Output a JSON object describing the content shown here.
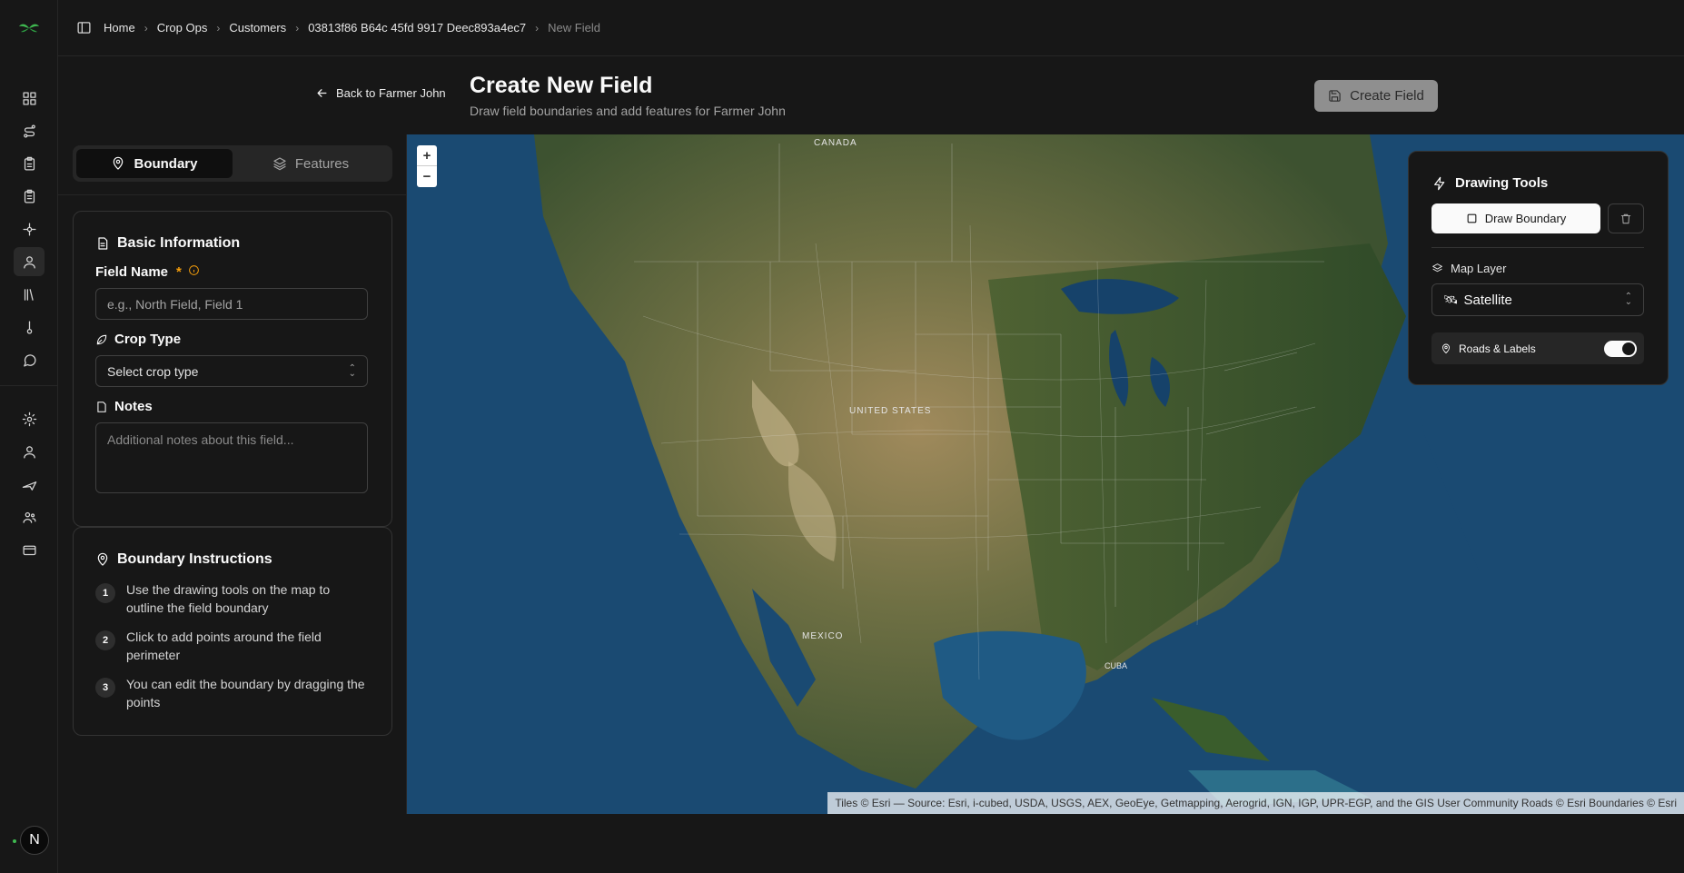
{
  "breadcrumbs": [
    "Home",
    "Crop Ops",
    "Customers",
    "03813f86 B64c 45fd 9917 Deec893a4ec7",
    "New Field"
  ],
  "header": {
    "back_label": "Back to Farmer John",
    "title": "Create New Field",
    "subtitle": "Draw field boundaries and add features for Farmer John",
    "create_label": "Create Field"
  },
  "tabs": [
    {
      "label": "Boundary",
      "active": true
    },
    {
      "label": "Features",
      "active": false
    }
  ],
  "basic_info": {
    "title": "Basic Information",
    "field_name_label": "Field Name",
    "field_name_required": "*",
    "field_name_placeholder": "e.g., North Field, Field 1",
    "crop_type_label": "Crop Type",
    "crop_type_value": "Select crop type",
    "notes_label": "Notes",
    "notes_placeholder": "Additional notes about this field..."
  },
  "instructions": {
    "title": "Boundary Instructions",
    "steps": [
      {
        "num": "1",
        "text": "Use the drawing tools on the map to outline the field boundary"
      },
      {
        "num": "2",
        "text": "Click to add points around the field perimeter"
      },
      {
        "num": "3",
        "text": "You can edit the boundary by dragging the points"
      }
    ]
  },
  "map": {
    "zoom_in": "+",
    "zoom_out": "−",
    "labels": {
      "canada": "CANADA",
      "us": "UNITED STATES",
      "mexico": "MEXICO",
      "cuba": "CUBA"
    },
    "attribution": "Tiles © Esri — Source: Esri, i-cubed, USDA, USGS, AEX, GeoEye, Getmapping, Aerogrid, IGN, IGP, UPR-EGP, and the GIS User Community Roads © Esri Boundaries © Esri"
  },
  "drawing_tools": {
    "title": "Drawing Tools",
    "draw_label": "Draw Boundary",
    "map_layer_label": "Map Layer",
    "map_layer_value": "Satellite",
    "roads_label": "Roads & Labels",
    "roads_enabled": true
  },
  "user": {
    "initial": "N"
  },
  "colors": {
    "accent": "#f59e0b",
    "background": "#171717"
  }
}
